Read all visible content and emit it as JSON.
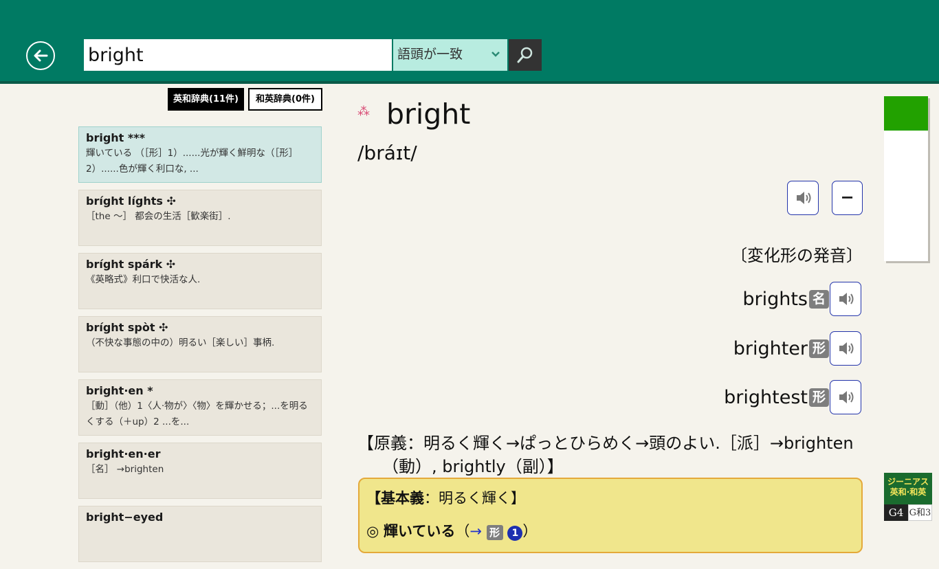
{
  "search": {
    "query": "bright",
    "match_mode": "語頭が一致"
  },
  "tabs": {
    "ej": "英和辞典(11件)",
    "je": "和英辞典(0件)"
  },
  "results": [
    {
      "head": "bright ***",
      "desc": "輝いている （［形］1）......光が輝く鮮明な（［形］2）......色が輝く利口な, ..."
    },
    {
      "head": "bríght líghts ✣",
      "desc": "［the ～］ 都会の生活［歓楽街］."
    },
    {
      "head": "bríght spárk ✣",
      "desc": "《英略式》利口で快活な人."
    },
    {
      "head": "bríght spòt ✣",
      "desc": "（不快な事態の中の）明るい［楽しい］事柄."
    },
    {
      "head": "bright·en *",
      "desc": "［動］（他）1〈人·物が〉〈物〉を輝かせる；...を明るくする（＋up）2 ...を..."
    },
    {
      "head": "bright·en·er",
      "desc": "［名］ →brighten"
    },
    {
      "head": "bright−eyed",
      "desc": ""
    }
  ],
  "entry": {
    "mark": "⁂",
    "headword": "bright",
    "pronunciation": "/bráɪt/",
    "minus_label": "−",
    "inflection_title": "〔変化形の発音〕",
    "inflections": [
      {
        "word": "brights",
        "pos": "名"
      },
      {
        "word": "brighter",
        "pos": "形"
      },
      {
        "word": "brightest",
        "pos": "形"
      }
    ],
    "etymology": "【原義：明るく輝く→ぱっとひらめく→頭のよい.［派］→brighten（動）, brightly（副）】",
    "basic_label": "【基本義",
    "basic_text": "：明るく輝く】",
    "sense_prefix": "◎",
    "sense_bold": "輝いている",
    "sense_open": "（",
    "sense_arrow": "→",
    "sense_pos": "形",
    "sense_num": "1",
    "sense_close": "）"
  },
  "logo": {
    "line1": "ジーニアス",
    "line2": "英和·和英",
    "g4": "G4",
    "g3": "G和3"
  },
  "colors": {
    "header": "#007a63",
    "select_bg": "#b8ece0",
    "selected_item": "#d2e8e5",
    "scroll_thumb": "#22a100",
    "basic_box": "#f0e68c"
  }
}
